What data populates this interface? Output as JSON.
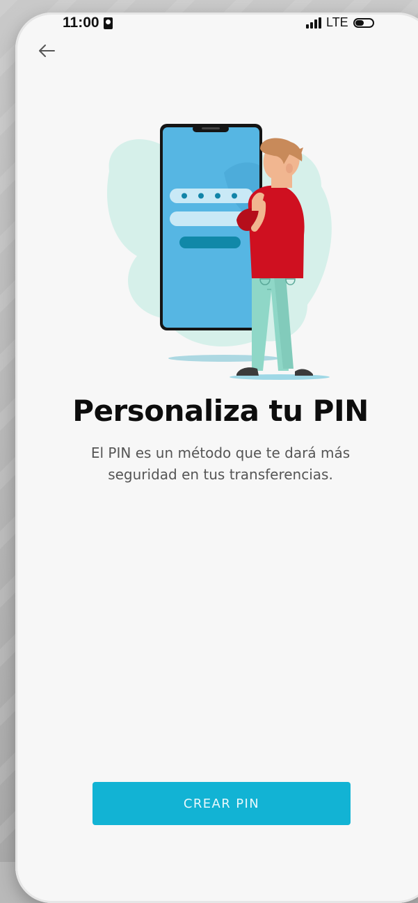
{
  "status_bar": {
    "time": "11:00",
    "network": "LTE"
  },
  "icons": {
    "back": "arrow-left-icon",
    "sim": "sim-card-icon",
    "signal": "signal-icon",
    "battery": "battery-icon"
  },
  "content": {
    "title": "Personaliza tu PIN",
    "subtitle": "El PIN es un método que te dará más seguridad en tus transferencias."
  },
  "cta": {
    "label": "CREAR PIN"
  },
  "colors": {
    "accent": "#12b3d4",
    "background": "#f7f7f7",
    "phone_screen": "#56b6e3",
    "shirt": "#cf1020",
    "pants": "#8fd7c7"
  }
}
